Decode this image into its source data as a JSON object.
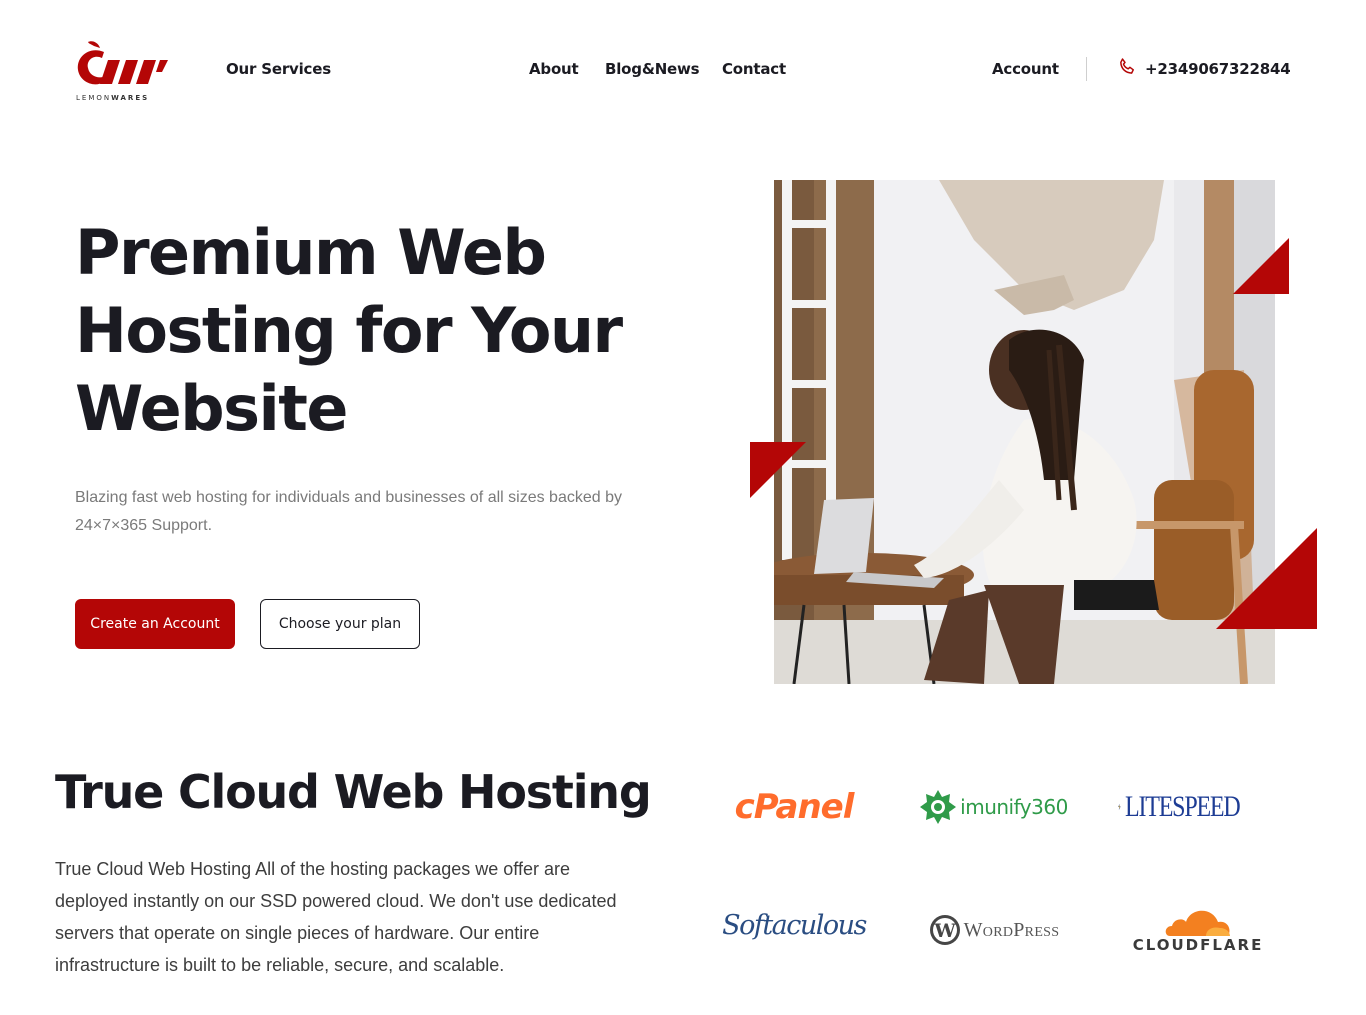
{
  "header": {
    "logo_text_a": "LEMON",
    "logo_text_b": "WARES",
    "nav": {
      "services": "Our Services",
      "about": "About",
      "blog": "Blog&News",
      "contact": "Contact",
      "account": "Account"
    },
    "phone": "+2349067322844"
  },
  "hero": {
    "title": "Premium Web Hosting for Your Website",
    "subtitle": "Blazing fast web hosting for individuals and businesses of all sizes backed by 24×7×365 Support.",
    "primary_button": "Create an Account",
    "secondary_button": "Choose your plan"
  },
  "section": {
    "title": "True Cloud Web Hosting",
    "body": "True Cloud Web Hosting All of the hosting packages we offer are deployed instantly on our SSD powered cloud. We don't use dedicated servers that operate on single pieces of hardware. Our entire infrastructure is built to be reliable, secure, and scalable."
  },
  "partners": {
    "cpanel": "cPanel",
    "imunify_a": "imunify",
    "imunify_b": "360",
    "litespeed": "LITESPEED",
    "softaculous": "Softaculous",
    "wordpress": "WordPress",
    "cloudflare": "CLOUDFLARE"
  },
  "colors": {
    "brand_red": "#b40606",
    "text_dark": "#1b1b22",
    "cpanel_orange": "#ff6c2c",
    "imunify_green": "#2f9b49",
    "litespeed_blue": "#1d3c94",
    "cloudflare_orange": "#f38020"
  }
}
